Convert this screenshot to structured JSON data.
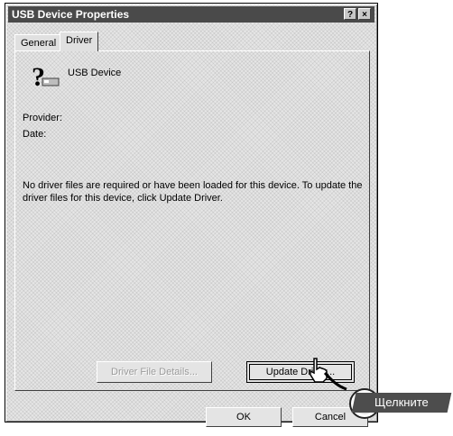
{
  "dialog": {
    "title": "USB Device Properties",
    "help_button": "?",
    "close_button": "×"
  },
  "tabs": [
    {
      "label": "General"
    },
    {
      "label": "Driver"
    }
  ],
  "driver": {
    "device_icon": "unknown-device-icon",
    "device_name": "USB Device",
    "provider_label": "Provider:",
    "date_label": "Date:",
    "message": "No driver files are required or have been loaded for this device. To update the driver files for this device, click Update Driver."
  },
  "buttons": {
    "driver_file_details": "Driver File Details...",
    "update_driver": "Update Driver...",
    "ok": "OK",
    "cancel": "Cancel"
  },
  "callout": {
    "text": "Щелкните"
  },
  "cursor_icon": "hand-pointer-icon",
  "colors": {
    "titlebar": "#4a4a4a",
    "callout": "#4d4d4d"
  }
}
